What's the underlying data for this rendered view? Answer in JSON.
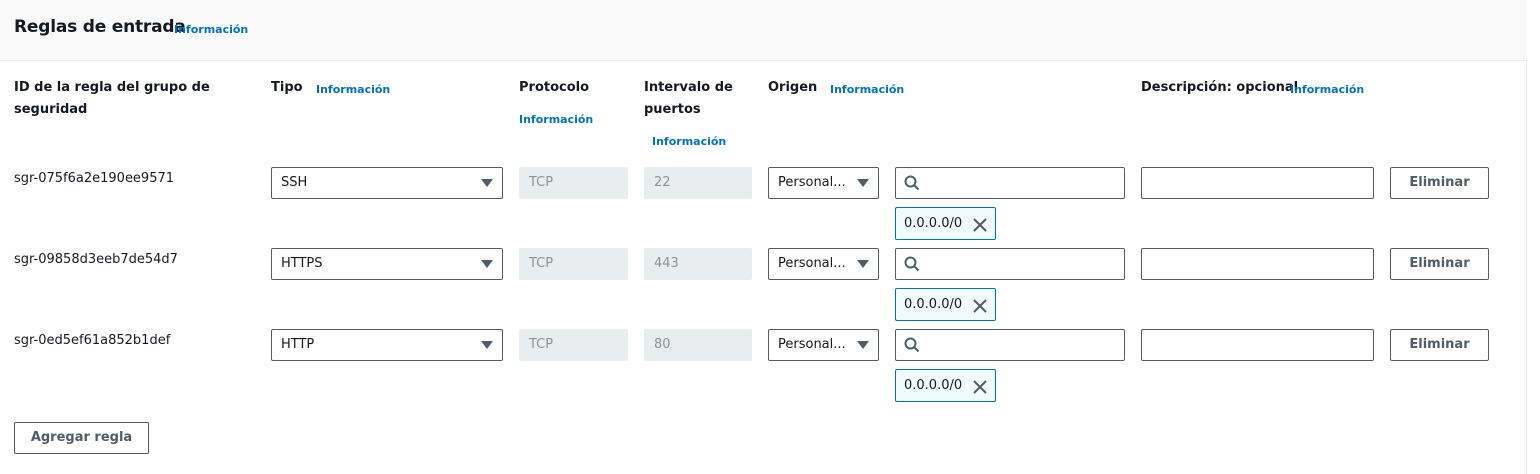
{
  "section": {
    "title": "Reglas de entrada",
    "info": "Información"
  },
  "columns": {
    "rule_id": "ID de la regla del grupo de seguridad",
    "rule_id_line1": "ID de la regla del grupo de",
    "rule_id_line2": "seguridad",
    "type": "Tipo",
    "type_info": "Información",
    "protocol": "Protocolo",
    "protocol_info": "Información",
    "port_range_line1": "Intervalo de",
    "port_range_line2": "puertos",
    "port_range_info": "Información",
    "source": "Origen",
    "source_info": "Información",
    "description": "Descripción: opcional",
    "description_info": "Información"
  },
  "rules": [
    {
      "id": "sgr-075f6a2e190ee9571",
      "type": "SSH",
      "protocol": "TCP",
      "port": "22",
      "source": "Personal...",
      "cidr": "0.0.0.0/0",
      "remove": "Eliminar"
    },
    {
      "id": "sgr-09858d3eeb7de54d7",
      "type": "HTTPS",
      "protocol": "TCP",
      "port": "443",
      "source": "Personal...",
      "cidr": "0.0.0.0/0",
      "remove": "Eliminar"
    },
    {
      "id": "sgr-0ed5ef61a852b1def",
      "type": "HTTP",
      "protocol": "TCP",
      "port": "80",
      "source": "Personal...",
      "cidr": "0.0.0.0/0",
      "remove": "Eliminar"
    }
  ],
  "add_rule": "Agregar regla",
  "icons": {
    "search": "search-icon",
    "dropdown": "caret-down-icon",
    "remove_token": "close-icon"
  },
  "colors": {
    "link": "#0073bb",
    "border": "#545b64",
    "token_bg": "#f1faff",
    "disabled_bg": "#eaeded"
  }
}
